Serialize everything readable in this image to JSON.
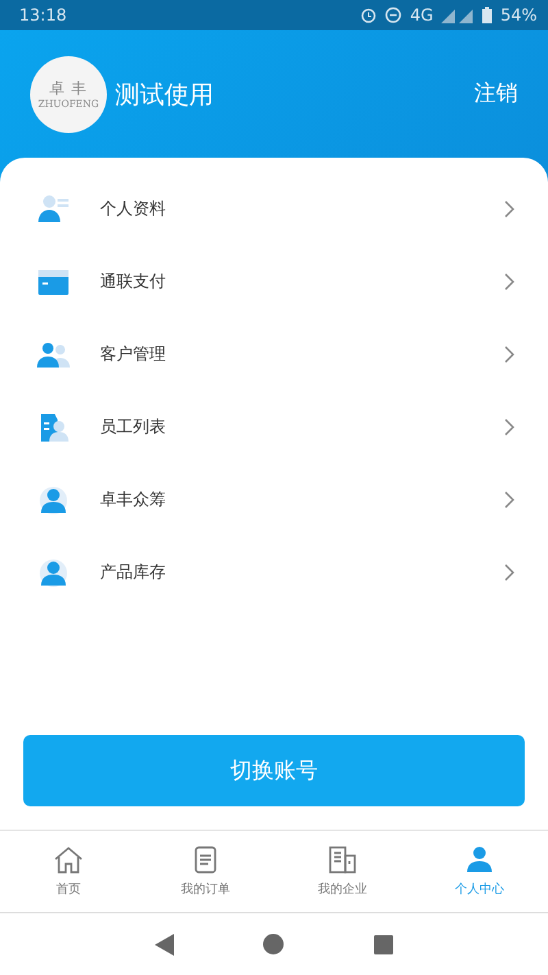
{
  "status_bar": {
    "time": "13:18",
    "network": "4G",
    "battery": "54%"
  },
  "profile": {
    "avatar_logo": "卓 丰",
    "avatar_sub": "ZHUOFENG",
    "name": "测试使用",
    "logout": "注销"
  },
  "menu": [
    {
      "kind": "profile",
      "label": "个人资料"
    },
    {
      "kind": "payment",
      "label": "通联支付"
    },
    {
      "kind": "customers",
      "label": "客户管理"
    },
    {
      "kind": "staff",
      "label": "员工列表"
    },
    {
      "kind": "person",
      "label": "卓丰众筹"
    },
    {
      "kind": "person",
      "label": "产品库存"
    }
  ],
  "switch_button": "切换账号",
  "tabs": [
    {
      "kind": "home",
      "label": "首页",
      "selected": false
    },
    {
      "kind": "orders",
      "label": "我的订单",
      "selected": false
    },
    {
      "kind": "company",
      "label": "我的企业",
      "selected": false
    },
    {
      "kind": "user",
      "label": "个人中心",
      "selected": true
    }
  ]
}
